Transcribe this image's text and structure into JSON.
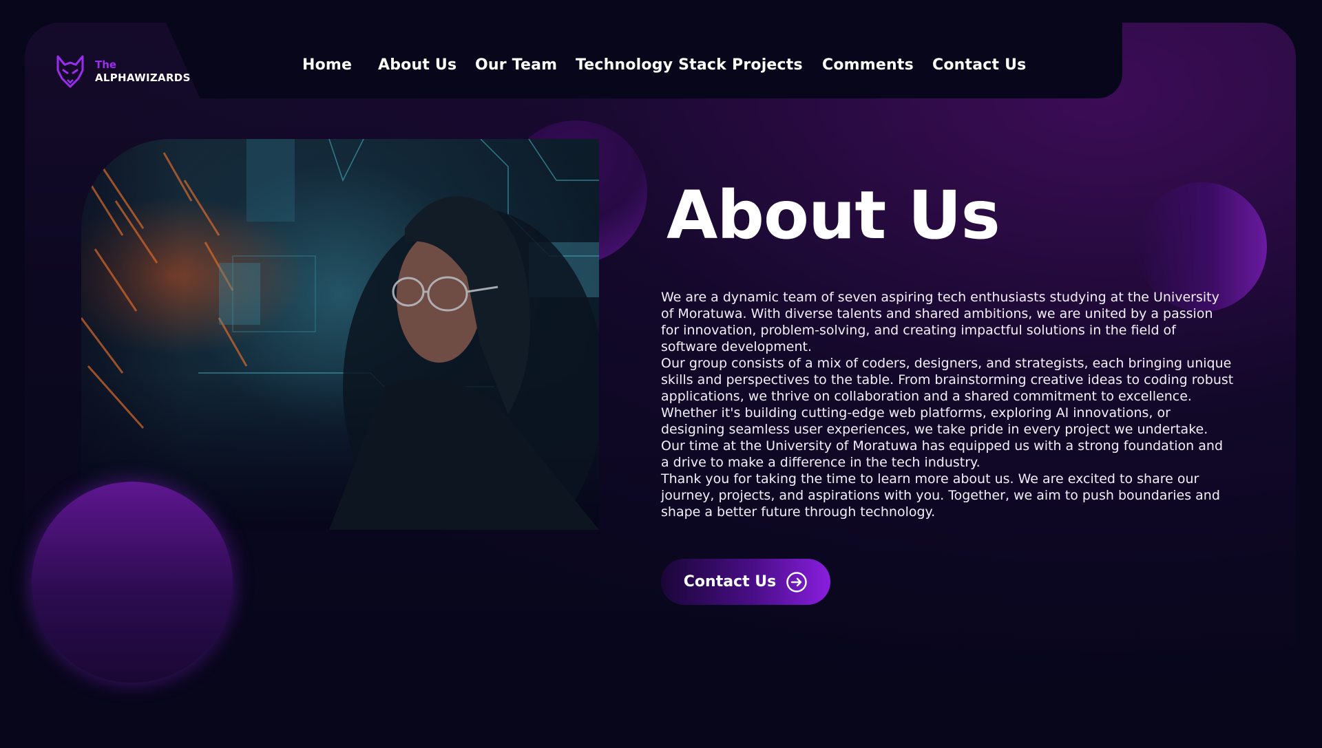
{
  "brand": {
    "prefix": "The",
    "name": "ALPHAWIZARDS",
    "logo_icon": "fox-head-icon",
    "accent_color": "#9b2cf0"
  },
  "nav": {
    "items": [
      {
        "label": "Home"
      },
      {
        "label": "About Us"
      },
      {
        "label": "Our Team"
      },
      {
        "label": "Technology Stack"
      },
      {
        "label": "Projects"
      },
      {
        "label": "Comments"
      },
      {
        "label": "Contact Us"
      }
    ]
  },
  "main": {
    "title": "About Us",
    "paragraphs": [
      "We are a dynamic team of seven aspiring tech enthusiasts studying at the University of Moratuwa. With diverse talents and shared ambitions, we are united by a passion for innovation, problem-solving, and creating impactful solutions in the field of software development.",
      "Our group consists of a mix of coders, designers, and strategists, each bringing unique skills and perspectives to the table. From brainstorming creative ideas to coding robust applications, we thrive on collaboration and a shared commitment to excellence.",
      "Whether it's building cutting-edge web platforms, exploring AI innovations, or designing seamless user experiences, we take pride in every project we undertake. Our time at the University of Moratuwa has equipped us with a strong foundation and a drive to make a difference in the tech industry.",
      "Thank you for taking the time to learn more about us. We are excited to share our journey, projects, and aspirations with you. Together, we aim to push boundaries and shape a better future through technology."
    ],
    "cta_label": "Contact Us",
    "cta_icon": "arrow-right-circle-icon"
  },
  "colors": {
    "background": "#07061a",
    "orb_purple": "#5e1690",
    "cta_gradient_end": "#8a1ee0"
  }
}
